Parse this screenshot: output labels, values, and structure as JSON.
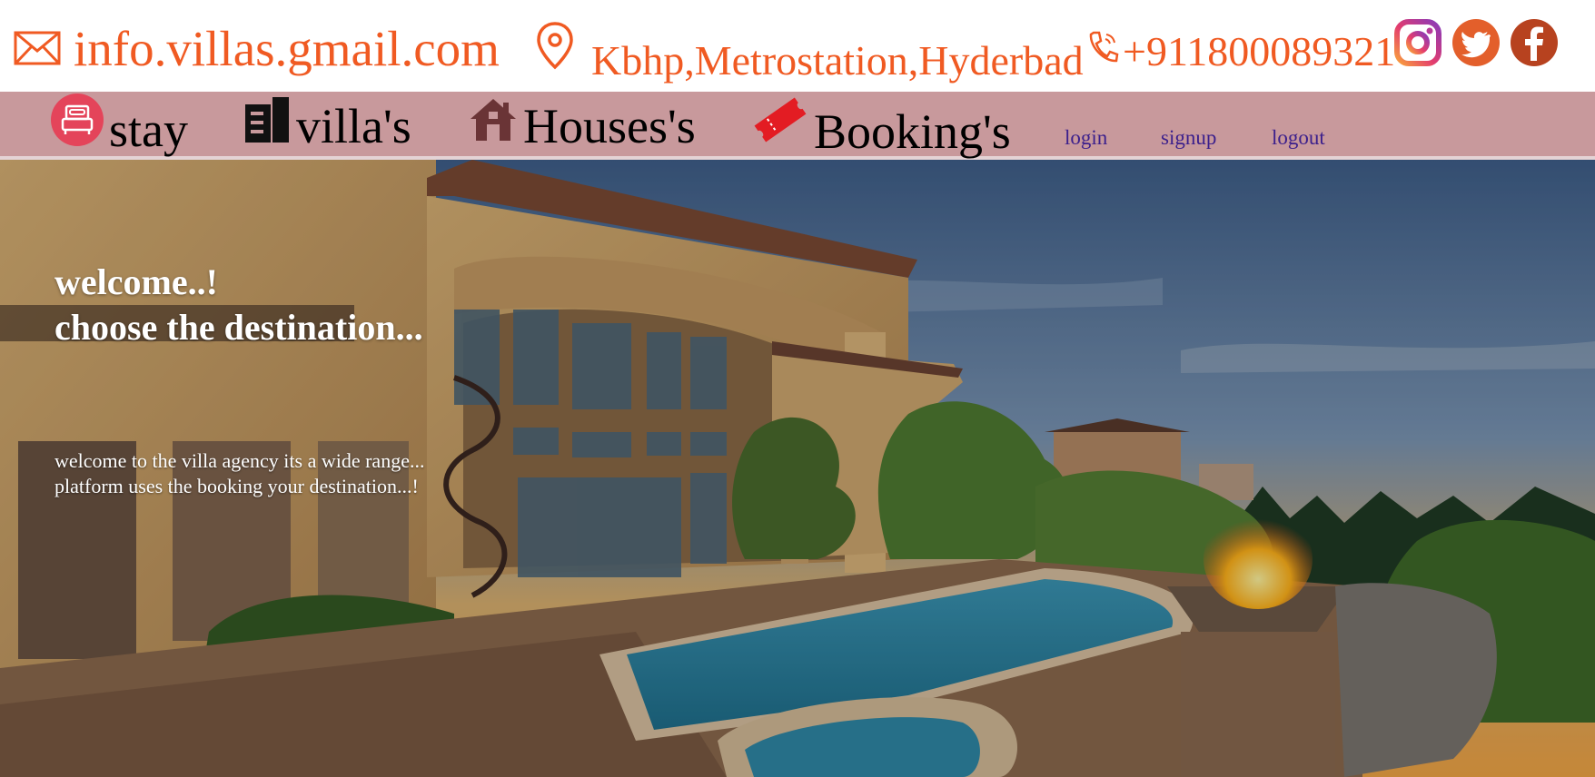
{
  "contact": {
    "email": "info.villas.gmail.com",
    "address": "Kbhp,Metrostation,Hyderbad",
    "phone": "+911800089321",
    "accent_color": "#f05a22",
    "icons": [
      "envelope-icon",
      "map-pin-icon",
      "phone-icon",
      "instagram-icon",
      "twitter-icon",
      "facebook-icon"
    ]
  },
  "nav": {
    "background": "#c8999c",
    "items": [
      {
        "label": "stay",
        "icon": "bed-icon"
      },
      {
        "label": "villa's",
        "icon": "building-icon"
      },
      {
        "label": "Houses's",
        "icon": "house-icon"
      },
      {
        "label": "Booking's",
        "icon": "ticket-icon"
      }
    ],
    "links": [
      {
        "label": "login"
      },
      {
        "label": "signup"
      },
      {
        "label": "logout"
      }
    ]
  },
  "hero": {
    "title": "welcome..!\nchoose the destination...",
    "text": "welcome to the villa agency its a wide range...\nplatform uses the booking your destination...!",
    "image": "villa-with-pool-at-sunset"
  }
}
